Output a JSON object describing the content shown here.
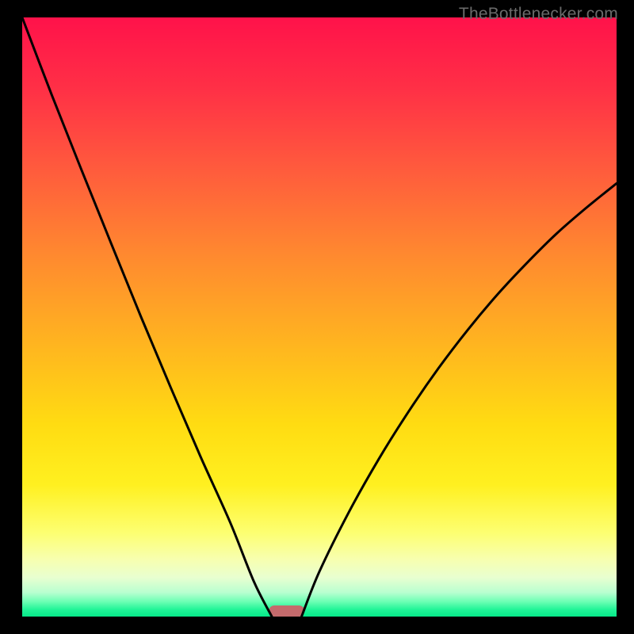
{
  "watermark": "TheBottlenecker.com",
  "chart_data": {
    "type": "line",
    "title": "",
    "xlabel": "",
    "ylabel": "",
    "xlim": [
      0,
      1
    ],
    "ylim": [
      0,
      1
    ],
    "axes_visible": false,
    "series": [
      {
        "name": "curve-left",
        "x": [
          0.0,
          0.05,
          0.1,
          0.15,
          0.2,
          0.25,
          0.3,
          0.35,
          0.39,
          0.42
        ],
        "y": [
          1.0,
          0.87,
          0.745,
          0.622,
          0.5,
          0.382,
          0.267,
          0.157,
          0.058,
          0.0
        ]
      },
      {
        "name": "curve-right",
        "x": [
          0.47,
          0.5,
          0.55,
          0.6,
          0.65,
          0.7,
          0.75,
          0.8,
          0.85,
          0.9,
          0.95,
          1.0
        ],
        "y": [
          0.0,
          0.075,
          0.175,
          0.263,
          0.342,
          0.414,
          0.479,
          0.538,
          0.591,
          0.64,
          0.683,
          0.723
        ]
      }
    ],
    "marker": {
      "x_center": 0.445,
      "y": 0.0,
      "width": 0.06,
      "color": "#c46a6c"
    },
    "background_gradient": {
      "type": "vertical",
      "stops": [
        {
          "pos": 0.0,
          "color": "#ff124a"
        },
        {
          "pos": 0.12,
          "color": "#ff3046"
        },
        {
          "pos": 0.25,
          "color": "#ff5a3d"
        },
        {
          "pos": 0.4,
          "color": "#ff8a2f"
        },
        {
          "pos": 0.55,
          "color": "#ffb61f"
        },
        {
          "pos": 0.68,
          "color": "#ffdc12"
        },
        {
          "pos": 0.78,
          "color": "#fff020"
        },
        {
          "pos": 0.86,
          "color": "#fdff71"
        },
        {
          "pos": 0.905,
          "color": "#f7ffb0"
        },
        {
          "pos": 0.935,
          "color": "#e8ffd0"
        },
        {
          "pos": 0.96,
          "color": "#b8ffd0"
        },
        {
          "pos": 0.975,
          "color": "#6cffb4"
        },
        {
          "pos": 0.988,
          "color": "#22f598"
        },
        {
          "pos": 1.0,
          "color": "#06e889"
        }
      ]
    },
    "curve_color": "#000000",
    "curve_width": 3
  }
}
